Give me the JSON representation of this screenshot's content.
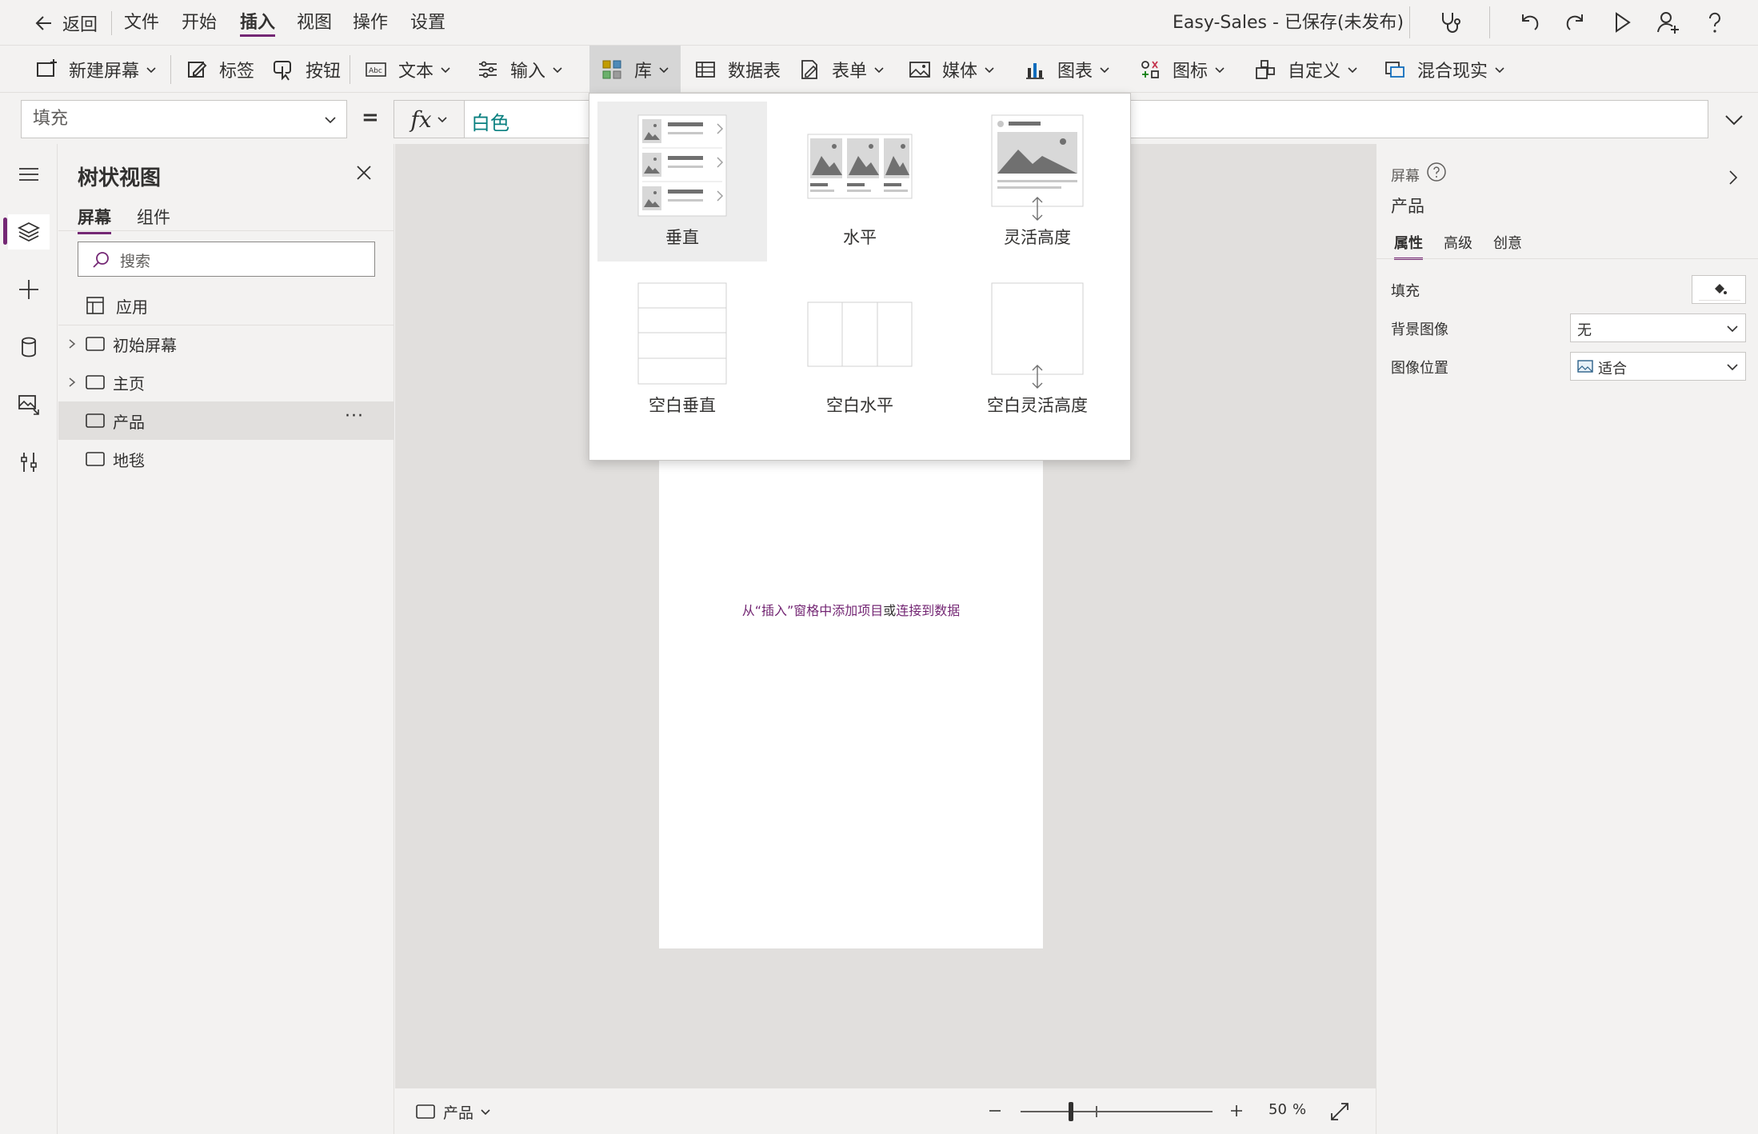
{
  "menu": {
    "back": "返回",
    "items": [
      "文件",
      "开始",
      "插入",
      "视图",
      "操作",
      "设置"
    ],
    "active": "插入",
    "app_title": "Easy-Sales - 已保存(未发布)"
  },
  "toolbar": {
    "new_screen": "新建屏幕",
    "label": "标签",
    "button": "按钮",
    "text": "文本",
    "input": "输入",
    "gallery": "库",
    "datatable": "数据表",
    "forms": "表单",
    "media": "媒体",
    "charts": "图表",
    "icons": "图标",
    "custom": "自定义",
    "mixed_reality": "混合现实"
  },
  "formula": {
    "property": "填充",
    "equals": "=",
    "fx": "fx",
    "value": "白色"
  },
  "tree": {
    "title": "树状视图",
    "tabs": [
      "屏幕",
      "组件"
    ],
    "search_placeholder": "搜索",
    "app_item": "应用",
    "screens": [
      {
        "label": "初始屏幕",
        "expandable": true
      },
      {
        "label": "主页",
        "expandable": true
      },
      {
        "label": "产品",
        "expandable": false,
        "selected": true,
        "more": "···"
      },
      {
        "label": "地毯",
        "expandable": false
      }
    ]
  },
  "canvas": {
    "hint_part1": "从“插入”窗格中添加项目",
    "hint_or": "或",
    "hint_link": "连接到数据"
  },
  "statusbar": {
    "screen": "产品",
    "zoom": "50",
    "zoom_unit": "%"
  },
  "properties": {
    "kind": "屏幕",
    "name": "产品",
    "tabs": [
      "属性",
      "高级",
      "创意"
    ],
    "rows": [
      {
        "label": "填充"
      },
      {
        "label": "背景图像",
        "value": "无"
      },
      {
        "label": "图像位置",
        "value": "适合"
      }
    ]
  },
  "gallery_menu": {
    "items": [
      "垂直",
      "水平",
      "灵活高度",
      "空白垂直",
      "空白水平",
      "空白灵活高度"
    ]
  },
  "colors": {
    "accent": "#742774",
    "formula_text": "#0a8080",
    "link": "#742774"
  }
}
